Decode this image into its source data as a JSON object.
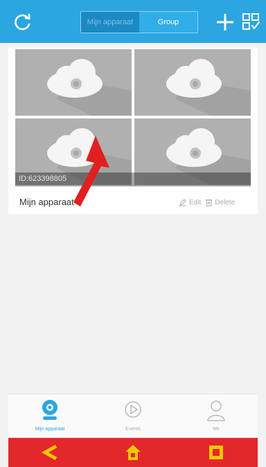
{
  "header": {
    "tabs": [
      {
        "label": "Mijn apparaat",
        "active": true
      },
      {
        "label": "Group",
        "active": false
      }
    ],
    "accent": "#2ba6e1",
    "refresh_icon": "refresh-icon",
    "add_icon": "plus-icon",
    "scan_icon": "qr-scan-icon"
  },
  "device": {
    "id_label": "ID:623398805",
    "name": "Mijn apparaat",
    "edit_label": "Edit",
    "delete_label": "Delete",
    "thumbnail_icon": "cloud-camera-icon",
    "thumbnails": 4
  },
  "bottom_tabs": [
    {
      "label": "Mijn apparaat",
      "icon": "camera-icon",
      "active": true
    },
    {
      "label": "Events",
      "icon": "play-circle-icon",
      "active": false
    },
    {
      "label": "Me",
      "icon": "person-icon",
      "active": false
    }
  ],
  "system_nav": {
    "color": "#e2282b",
    "icons": [
      "back-icon",
      "home-icon",
      "recents-icon"
    ]
  },
  "annotation": {
    "color": "#e0201f",
    "icon": "red-arrow-icon"
  }
}
